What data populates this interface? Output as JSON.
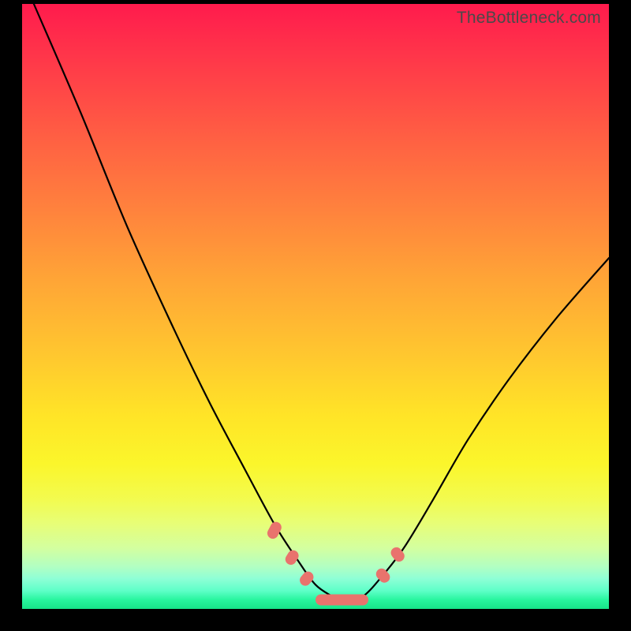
{
  "watermark": "TheBottleneck.com",
  "colors": {
    "bg": "#000000",
    "curve": "#000000",
    "capsule": "#e9736d",
    "gradient_top": "#ff1b4d",
    "gradient_bottom": "#17e388"
  },
  "chart_data": {
    "type": "line",
    "title": "",
    "xlabel": "",
    "ylabel": "",
    "xlim": [
      0,
      100
    ],
    "ylim": [
      0,
      100
    ],
    "series": [
      {
        "name": "left-curve",
        "x": [
          2,
          10,
          18,
          26,
          32,
          38,
          43,
          47,
          50,
          53,
          55
        ],
        "y": [
          100,
          82,
          63,
          46,
          34,
          23,
          14,
          8,
          4,
          2,
          1
        ]
      },
      {
        "name": "right-curve",
        "x": [
          55,
          58,
          61,
          65,
          70,
          76,
          83,
          91,
          100
        ],
        "y": [
          1,
          2,
          5,
          10,
          18,
          28,
          38,
          48,
          58
        ]
      }
    ],
    "marker_zones": [
      {
        "name": "left-mark-1",
        "cx": 43.0,
        "cy": 13.0,
        "len": 3.0,
        "angle": -62
      },
      {
        "name": "left-mark-2",
        "cx": 46.0,
        "cy": 8.5,
        "len": 2.6,
        "angle": -58
      },
      {
        "name": "left-mark-3",
        "cx": 48.5,
        "cy": 5.0,
        "len": 2.6,
        "angle": -50
      },
      {
        "name": "bottom-flat",
        "cx": 54.5,
        "cy": 1.5,
        "len": 9.0,
        "angle": 0
      },
      {
        "name": "right-mark-1",
        "cx": 61.5,
        "cy": 5.5,
        "len": 2.6,
        "angle": 48
      },
      {
        "name": "right-mark-2",
        "cx": 64.0,
        "cy": 9.0,
        "len": 2.6,
        "angle": 52
      }
    ]
  }
}
